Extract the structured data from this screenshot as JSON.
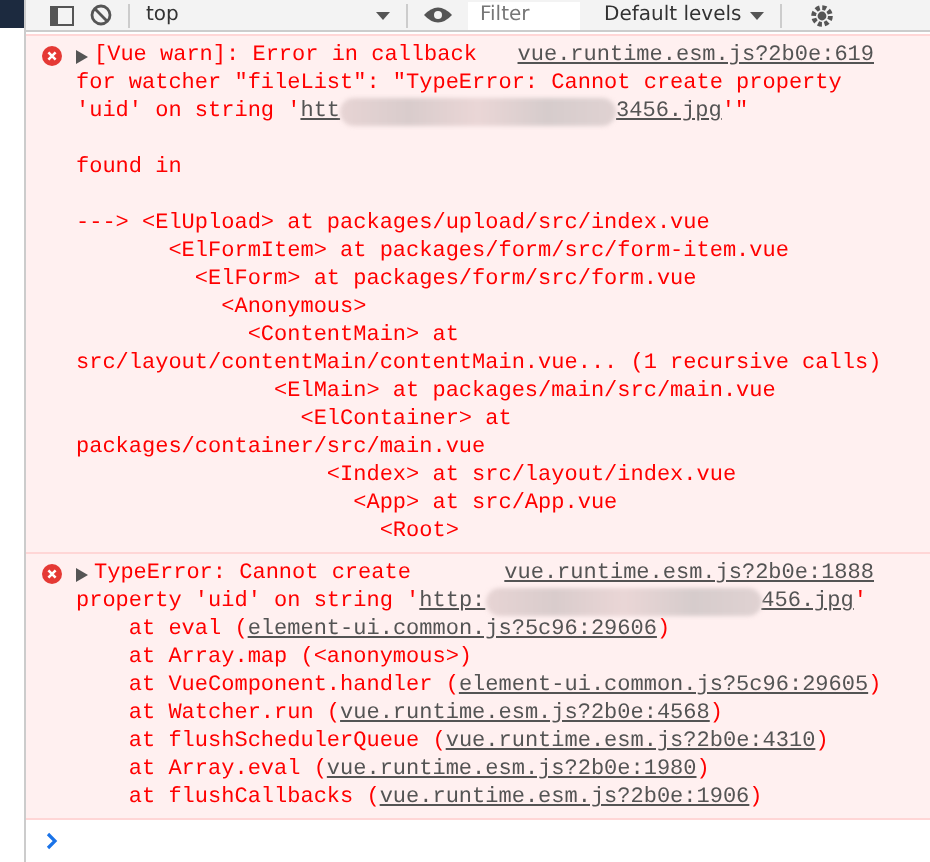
{
  "toolbar": {
    "context": "top",
    "filter": {
      "placeholder": "Filter"
    },
    "levels": "Default levels"
  },
  "messages": [
    {
      "kind": "error",
      "expanded": false,
      "source": "vue.runtime.esm.js?2b0e:619",
      "blocks": [
        {
          "lines": [
            {
              "segments": [
                {
                  "kind": "text",
                  "text": "[Vue warn]: Error in callback"
                }
              ]
            },
            {
              "segments": [
                {
                  "kind": "text",
                  "text": "for watcher \"fileList\": \"TypeError: Cannot create property"
                }
              ]
            },
            {
              "segments": [
                {
                  "kind": "text",
                  "text": "'uid' on string '"
                },
                {
                  "kind": "link",
                  "text": "htt"
                },
                {
                  "kind": "redacted"
                },
                {
                  "kind": "link",
                  "text": "3456.jpg"
                },
                {
                  "kind": "text",
                  "text": "'\""
                }
              ]
            }
          ]
        },
        {
          "lines": [
            {
              "segments": [
                {
                  "kind": "text",
                  "text": "found in"
                }
              ]
            }
          ]
        },
        {
          "lines": [
            {
              "segments": [
                {
                  "kind": "text",
                  "text": "---> <ElUpload> at packages/upload/src/index.vue"
                }
              ]
            },
            {
              "segments": [
                {
                  "kind": "text",
                  "text": "       <ElFormItem> at packages/form/src/form-item.vue"
                }
              ]
            },
            {
              "segments": [
                {
                  "kind": "text",
                  "text": "         <ElForm> at packages/form/src/form.vue"
                }
              ]
            },
            {
              "segments": [
                {
                  "kind": "text",
                  "text": "           <Anonymous>"
                }
              ]
            },
            {
              "segments": [
                {
                  "kind": "text",
                  "text": "             <ContentMain> at"
                }
              ]
            },
            {
              "segments": [
                {
                  "kind": "text",
                  "text": "src/layout/contentMain/contentMain.vue... (1 recursive calls)"
                }
              ]
            },
            {
              "segments": [
                {
                  "kind": "text",
                  "text": "               <ElMain> at packages/main/src/main.vue"
                }
              ]
            },
            {
              "segments": [
                {
                  "kind": "text",
                  "text": "                 <ElContainer> at"
                }
              ]
            },
            {
              "segments": [
                {
                  "kind": "text",
                  "text": "packages/container/src/main.vue"
                }
              ]
            },
            {
              "segments": [
                {
                  "kind": "text",
                  "text": "                   <Index> at src/layout/index.vue"
                }
              ]
            },
            {
              "segments": [
                {
                  "kind": "text",
                  "text": "                     <App> at src/App.vue"
                }
              ]
            },
            {
              "segments": [
                {
                  "kind": "text",
                  "text": "                       <Root>"
                }
              ]
            }
          ]
        }
      ]
    },
    {
      "kind": "error",
      "expanded": false,
      "source": "vue.runtime.esm.js?2b0e:1888",
      "blocks": [
        {
          "lines": [
            {
              "segments": [
                {
                  "kind": "text",
                  "text": "TypeError: Cannot create"
                }
              ]
            },
            {
              "segments": [
                {
                  "kind": "text",
                  "text": "property 'uid' on string '"
                },
                {
                  "kind": "link",
                  "text": "http:"
                },
                {
                  "kind": "redacted"
                },
                {
                  "kind": "link",
                  "text": "456.jpg"
                },
                {
                  "kind": "text",
                  "text": "'"
                }
              ]
            },
            {
              "segments": [
                {
                  "kind": "text",
                  "text": "    at eval ("
                },
                {
                  "kind": "link",
                  "text": "element-ui.common.js?5c96:29606"
                },
                {
                  "kind": "text",
                  "text": ")"
                }
              ]
            },
            {
              "segments": [
                {
                  "kind": "text",
                  "text": "    at Array.map (<anonymous>)"
                }
              ]
            },
            {
              "segments": [
                {
                  "kind": "text",
                  "text": "    at VueComponent.handler ("
                },
                {
                  "kind": "link",
                  "text": "element-ui.common.js?5c96:29605"
                },
                {
                  "kind": "text",
                  "text": ")"
                }
              ]
            },
            {
              "segments": [
                {
                  "kind": "text",
                  "text": "    at Watcher.run ("
                },
                {
                  "kind": "link",
                  "text": "vue.runtime.esm.js?2b0e:4568"
                },
                {
                  "kind": "text",
                  "text": ")"
                }
              ]
            },
            {
              "segments": [
                {
                  "kind": "text",
                  "text": "    at flushSchedulerQueue ("
                },
                {
                  "kind": "link",
                  "text": "vue.runtime.esm.js?2b0e:4310"
                },
                {
                  "kind": "text",
                  "text": ")"
                }
              ]
            },
            {
              "segments": [
                {
                  "kind": "text",
                  "text": "    at Array.eval ("
                },
                {
                  "kind": "link",
                  "text": "vue.runtime.esm.js?2b0e:1980"
                },
                {
                  "kind": "text",
                  "text": ")"
                }
              ]
            },
            {
              "segments": [
                {
                  "kind": "text",
                  "text": "    at flushCallbacks ("
                },
                {
                  "kind": "link",
                  "text": "vue.runtime.esm.js?2b0e:1906"
                },
                {
                  "kind": "text",
                  "text": ")"
                }
              ]
            }
          ]
        }
      ]
    }
  ]
}
